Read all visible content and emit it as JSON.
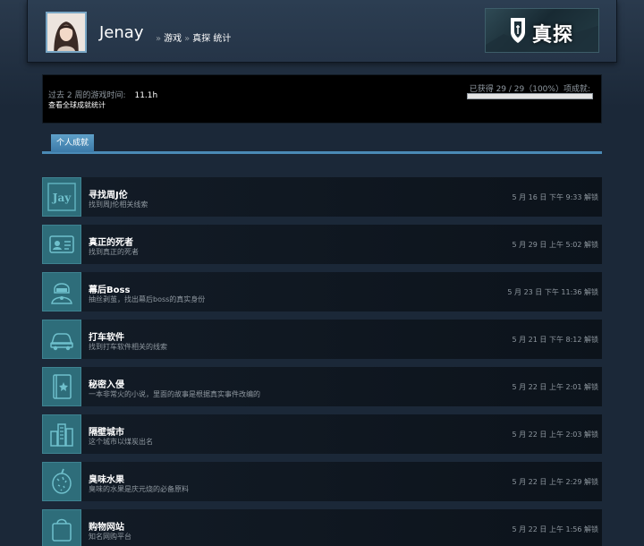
{
  "header": {
    "username": "Jenay",
    "breadcrumb": {
      "sep1": "»",
      "games": "游戏",
      "sep2": "»",
      "game_stats": "真探 统计"
    },
    "game_logo_text": "真探"
  },
  "stats": {
    "played_label": "过去 2 周的游戏时间:",
    "played_hours": "11.1h",
    "global_link": "查看全球成就统计",
    "progress_label": "已获得 29 / 29（100%）项成就:",
    "progress_fraction": 1.0
  },
  "tabs": [
    {
      "label": "个人成就"
    }
  ],
  "achievements": [
    {
      "title": "寻找周J伦",
      "desc": "找到周J伦相关线索",
      "date": "5 月 16 日 下午 9:33 解锁",
      "icon": "jay-icon"
    },
    {
      "title": "真正的死者",
      "desc": "找到真正的死者",
      "date": "5 月 29 日 上午 5:02 解锁",
      "icon": "id-card-icon"
    },
    {
      "title": "幕后Boss",
      "desc": "抽丝剥茧，找出幕后boss的真实身份",
      "date": "5 月 23 日 下午 11:36 解锁",
      "icon": "masked-figure-icon"
    },
    {
      "title": "打车软件",
      "desc": "找到打车软件相关的线索",
      "date": "5 月 21 日 下午 8:12 解锁",
      "icon": "car-icon"
    },
    {
      "title": "秘密入侵",
      "desc": "一本非常火的小说，里面的故事是根据真实事件改编的",
      "date": "5 月 22 日 上午 2:01 解锁",
      "icon": "book-icon"
    },
    {
      "title": "隔壁城市",
      "desc": "这个城市以煤炭出名",
      "date": "5 月 22 日 上午 2:03 解锁",
      "icon": "city-icon"
    },
    {
      "title": "臭味水果",
      "desc": "臭味的水果是庆元烧的必备原料",
      "date": "5 月 22 日 上午 2:29 解锁",
      "icon": "durian-icon"
    },
    {
      "title": "购物网站",
      "desc": "知名网购平台",
      "date": "5 月 22 日 上午 1:56 解锁",
      "icon": "shopping-bag-icon"
    }
  ]
}
